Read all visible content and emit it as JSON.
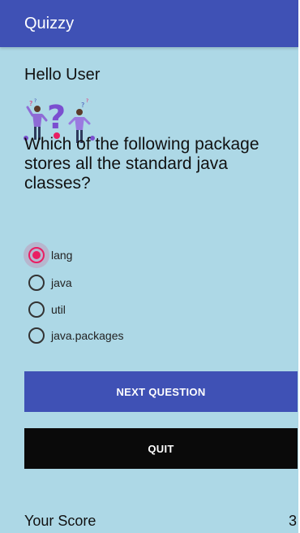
{
  "app_bar": {
    "title": "Quizzy"
  },
  "greeting": "Hello User",
  "question": "Which of the following package stores all the standard java classes?",
  "options": [
    {
      "label": "lang",
      "selected": true
    },
    {
      "label": "java",
      "selected": false
    },
    {
      "label": "util",
      "selected": false
    },
    {
      "label": "java.packages",
      "selected": false
    }
  ],
  "buttons": {
    "next_label": "NEXT QUESTION",
    "quit_label": "QUIT"
  },
  "score": {
    "label": "Your Score",
    "value": "3"
  },
  "colors": {
    "primary": "#3f51b5",
    "accent": "#e91e63",
    "background": "#add8e6",
    "quit_button": "#0a0a0a"
  },
  "icons": {
    "illustration": "quiz-people-question-mark-illustration"
  }
}
